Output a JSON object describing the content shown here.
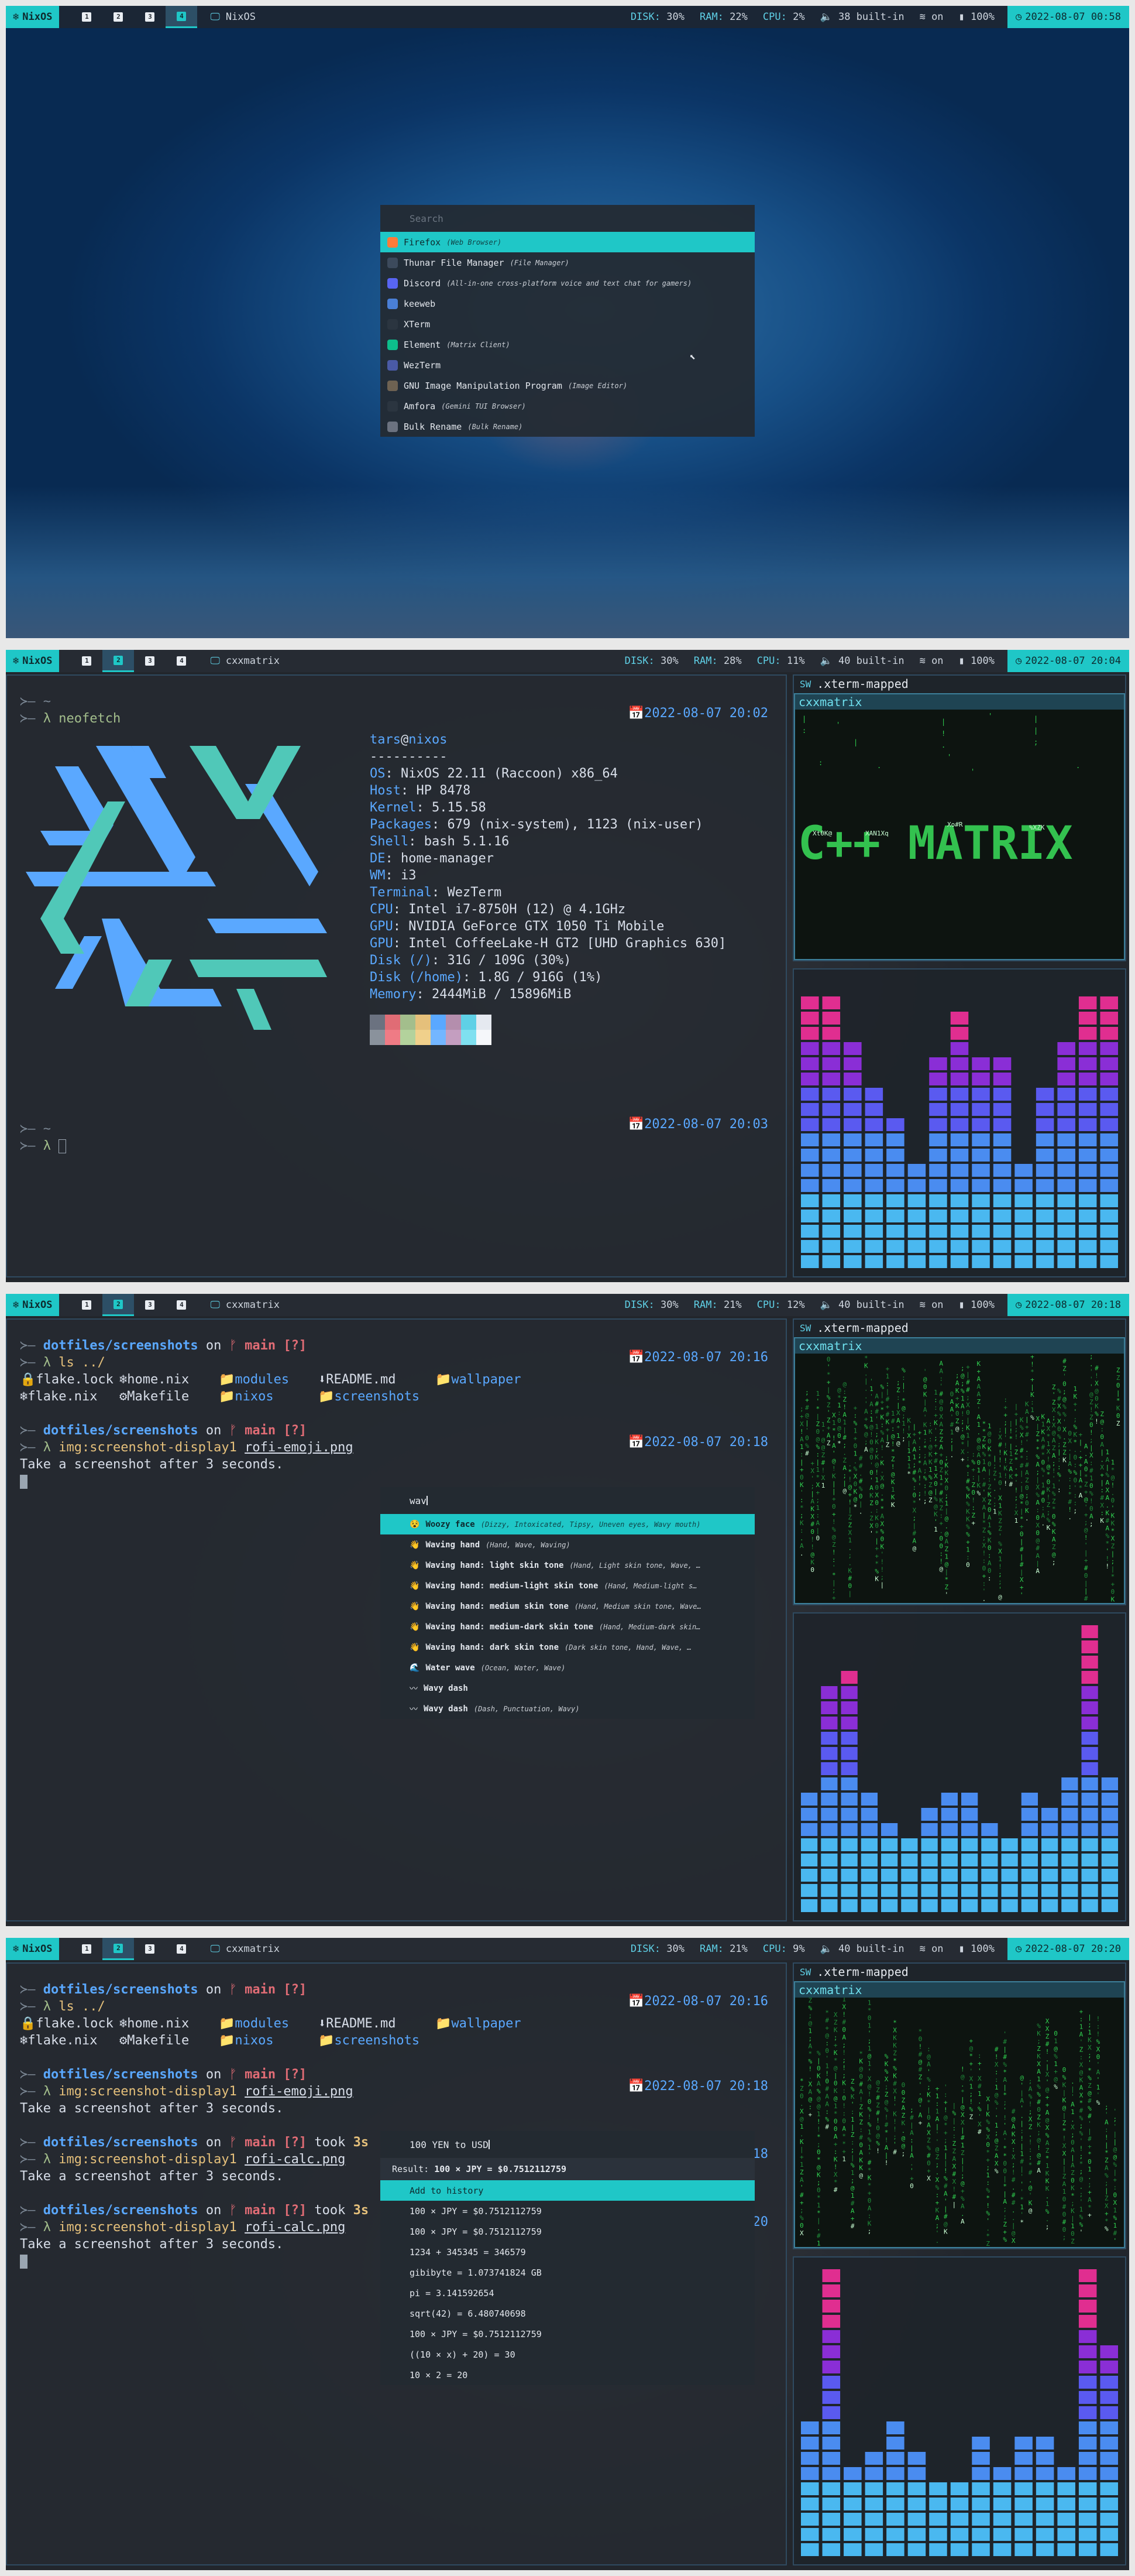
{
  "colors": {
    "accent": "#1fc7c7",
    "blue": "#5aa8ff",
    "green": "#a3be8c",
    "red": "#e06c75",
    "yellow": "#e5c07b"
  },
  "bar": {
    "logo_label": "NixOS",
    "workspaces": [
      "1",
      "2",
      "3",
      "4"
    ],
    "disk_label": "DISK:",
    "disk": "30%",
    "ram_label": "RAM:",
    "cpu_label": "CPU:",
    "battery": "100%",
    "wifi": "on"
  },
  "screens": [
    {
      "window_title": "NixOS",
      "ram": "22%",
      "cpu": "2%",
      "volume": "38 built-in",
      "clock": "2022-08-07 00:58",
      "rofi": {
        "placeholder": "Search",
        "items": [
          {
            "name": "Firefox",
            "desc": "(Web Browser)"
          },
          {
            "name": "Thunar File Manager",
            "desc": "(File Manager)"
          },
          {
            "name": "Discord",
            "desc": "(All-in-one cross-platform voice and text chat for gamers)"
          },
          {
            "name": "keeweb",
            "desc": ""
          },
          {
            "name": "XTerm",
            "desc": ""
          },
          {
            "name": "Element",
            "desc": "(Matrix Client)"
          },
          {
            "name": "WezTerm",
            "desc": ""
          },
          {
            "name": "GNU Image Manipulation Program",
            "desc": "(Image Editor)"
          },
          {
            "name": "Amfora",
            "desc": "(Gemini TUI Browser)"
          },
          {
            "name": "Bulk Rename",
            "desc": "(Bulk Rename)"
          }
        ]
      }
    },
    {
      "window_title": "cxxmatrix",
      "ram": "28%",
      "cpu": "11%",
      "volume": "40 built-in",
      "clock": "2022-08-07 20:04",
      "prompt_dir": "~",
      "command": "neofetch",
      "stamp1": "2022-08-07 20:02",
      "stamp2": "2022-08-07 20:03",
      "neofetch": {
        "user": "tars",
        "host_name": "nixos",
        "separator": "----------",
        "fields": [
          {
            "k": "OS",
            "v": "NixOS 22.11 (Raccoon) x86_64"
          },
          {
            "k": "Host",
            "v": "HP 8478"
          },
          {
            "k": "Kernel",
            "v": "5.15.58"
          },
          {
            "k": "Packages",
            "v": "679 (nix-system), 1123 (nix-user)"
          },
          {
            "k": "Shell",
            "v": "bash 5.1.16"
          },
          {
            "k": "DE",
            "v": "home-manager"
          },
          {
            "k": "WM",
            "v": "i3"
          },
          {
            "k": "Terminal",
            "v": "WezTerm"
          },
          {
            "k": "CPU",
            "v": "Intel i7-8750H (12) @ 4.1GHz"
          },
          {
            "k": "GPU",
            "v": "NVIDIA GeForce GTX 1050 Ti Mobile"
          },
          {
            "k": "GPU",
            "v": "Intel CoffeeLake-H GT2 [UHD Graphics 630]"
          },
          {
            "k": "Disk (/)",
            "v": "31G / 109G (30%)"
          },
          {
            "k": "Disk (/home)",
            "v": "1.8G / 916G (1%)"
          },
          {
            "k": "Memory",
            "v": "2444MiB / 15896MiB"
          }
        ],
        "swatch_row1": [
          "#6b7280",
          "#e06c75",
          "#a3be8c",
          "#e5c07b",
          "#5aa8ff",
          "#b48ead",
          "#5fd0e6",
          "#e5e9f0"
        ],
        "swatch_row2": [
          "#8a929c",
          "#ef7b85",
          "#b3d29c",
          "#f0d08b",
          "#73b6ff",
          "#c49ec0",
          "#7fe0f0",
          "#f5f7fa"
        ]
      },
      "side": {
        "sw_label": "SW",
        "title": ".xterm-mapped",
        "inner_title": "cxxmatrix"
      },
      "bars": [
        0.97,
        0.97,
        0.81,
        0.63,
        0.54,
        0.35,
        0.77,
        0.91,
        0.74,
        0.74,
        0.39,
        0.63,
        0.81,
        0.97,
        0.97
      ]
    },
    {
      "window_title": "cxxmatrix",
      "ram": "21%",
      "cpu": "12%",
      "volume": "40 built-in",
      "clock": "2022-08-07 20:18",
      "rofi_query": "wav",
      "emoji_items": [
        {
          "glyph": "😵",
          "name": "Woozy face",
          "desc": "(Dizzy, Intoxicated, Tipsy, Uneven eyes, Wavy mouth)"
        },
        {
          "glyph": "👋",
          "name": "Waving hand",
          "desc": "(Hand, Wave, Waving)"
        },
        {
          "glyph": "👋",
          "name": "Waving hand: light skin tone",
          "desc": "(Hand, Light skin tone, Wave, …"
        },
        {
          "glyph": "👋",
          "name": "Waving hand: medium-light skin tone",
          "desc": "(Hand, Medium-light s…"
        },
        {
          "glyph": "👋",
          "name": "Waving hand: medium skin tone",
          "desc": "(Hand, Medium skin tone, Wave…"
        },
        {
          "glyph": "👋",
          "name": "Waving hand: medium-dark skin tone",
          "desc": "(Hand, Medium-dark skin…"
        },
        {
          "glyph": "👋",
          "name": "Waving hand: dark skin tone",
          "desc": "(Dark skin tone, Hand, Wave, …"
        },
        {
          "glyph": "🌊",
          "name": "Water wave",
          "desc": "(Ocean, Water, Wave)"
        },
        {
          "glyph": "〰",
          "name": "Wavy dash",
          "desc": ""
        },
        {
          "glyph": "〰",
          "name": "Wavy dash",
          "desc": "(Dash, Punctuation, Wavy)"
        }
      ],
      "bars": [
        0.45,
        0.79,
        0.88,
        0.43,
        0.32,
        0.27,
        0.37,
        0.45,
        0.44,
        0.34,
        0.26,
        0.41,
        0.37,
        0.51,
        1.0,
        0.49
      ]
    },
    {
      "window_title": "cxxmatrix",
      "ram": "21%",
      "cpu": "9%",
      "volume": "40 built-in",
      "clock": "2022-08-07 20:20",
      "calc": {
        "query": "100 YEN to USD",
        "result_label": "Result:",
        "result_value": "100 × JPY = $0.7512112759",
        "add_label": "Add to history",
        "history": [
          "100 × JPY = $0.7512112759",
          "100 × JPY = $0.7512112759",
          "1234 + 345345 = 346579",
          "gibibyte = 1.073741824 GB",
          "pi = 3.141592654",
          "sqrt(42) = 6.480740698",
          "100 × JPY = $0.7512112759",
          "((10 × x) + 20) = 30",
          "10 × 2 = 20"
        ]
      },
      "bars": [
        0.48,
        1.0,
        0.33,
        0.4,
        0.5,
        0.4,
        0.28,
        0.27,
        0.45,
        0.33,
        0.43,
        0.45,
        0.33,
        1.0,
        0.76
      ]
    }
  ],
  "shell": {
    "dir": "dotfiles/screenshots",
    "on": "on",
    "branch_icon": "ᚠ",
    "branch": "main",
    "status": "[?]",
    "took": "took",
    "took_time": "3s",
    "ls_cmd": "ls ../",
    "files": [
      {
        "icon": "🔒",
        "name": "flake.lock",
        "kind": "file"
      },
      {
        "icon": "❄",
        "name": "home.nix",
        "kind": "file"
      },
      {
        "icon": "📁",
        "name": "modules",
        "kind": "dir"
      },
      {
        "icon": "⬇",
        "name": "README.md",
        "kind": "file"
      },
      {
        "icon": "📁",
        "name": "wallpaper",
        "kind": "dir"
      },
      {
        "icon": "❄",
        "name": "flake.nix",
        "kind": "file"
      },
      {
        "icon": "⚙",
        "name": "Makefile",
        "kind": "file"
      },
      {
        "icon": "📁",
        "name": "nixos",
        "kind": "dir"
      },
      {
        "icon": "📁",
        "name": "screenshots",
        "kind": "dir"
      }
    ],
    "shot_cmd": "img:screenshot-display1",
    "emoji_file": "rofi-emoji.png",
    "calc_file": "rofi-calc.png",
    "msg": "Take a screenshot after 3 seconds.",
    "stamp_a": "2022-08-07 20:16",
    "stamp_b": "2022-08-07 20:18",
    "stamp_c_tail": "20"
  }
}
